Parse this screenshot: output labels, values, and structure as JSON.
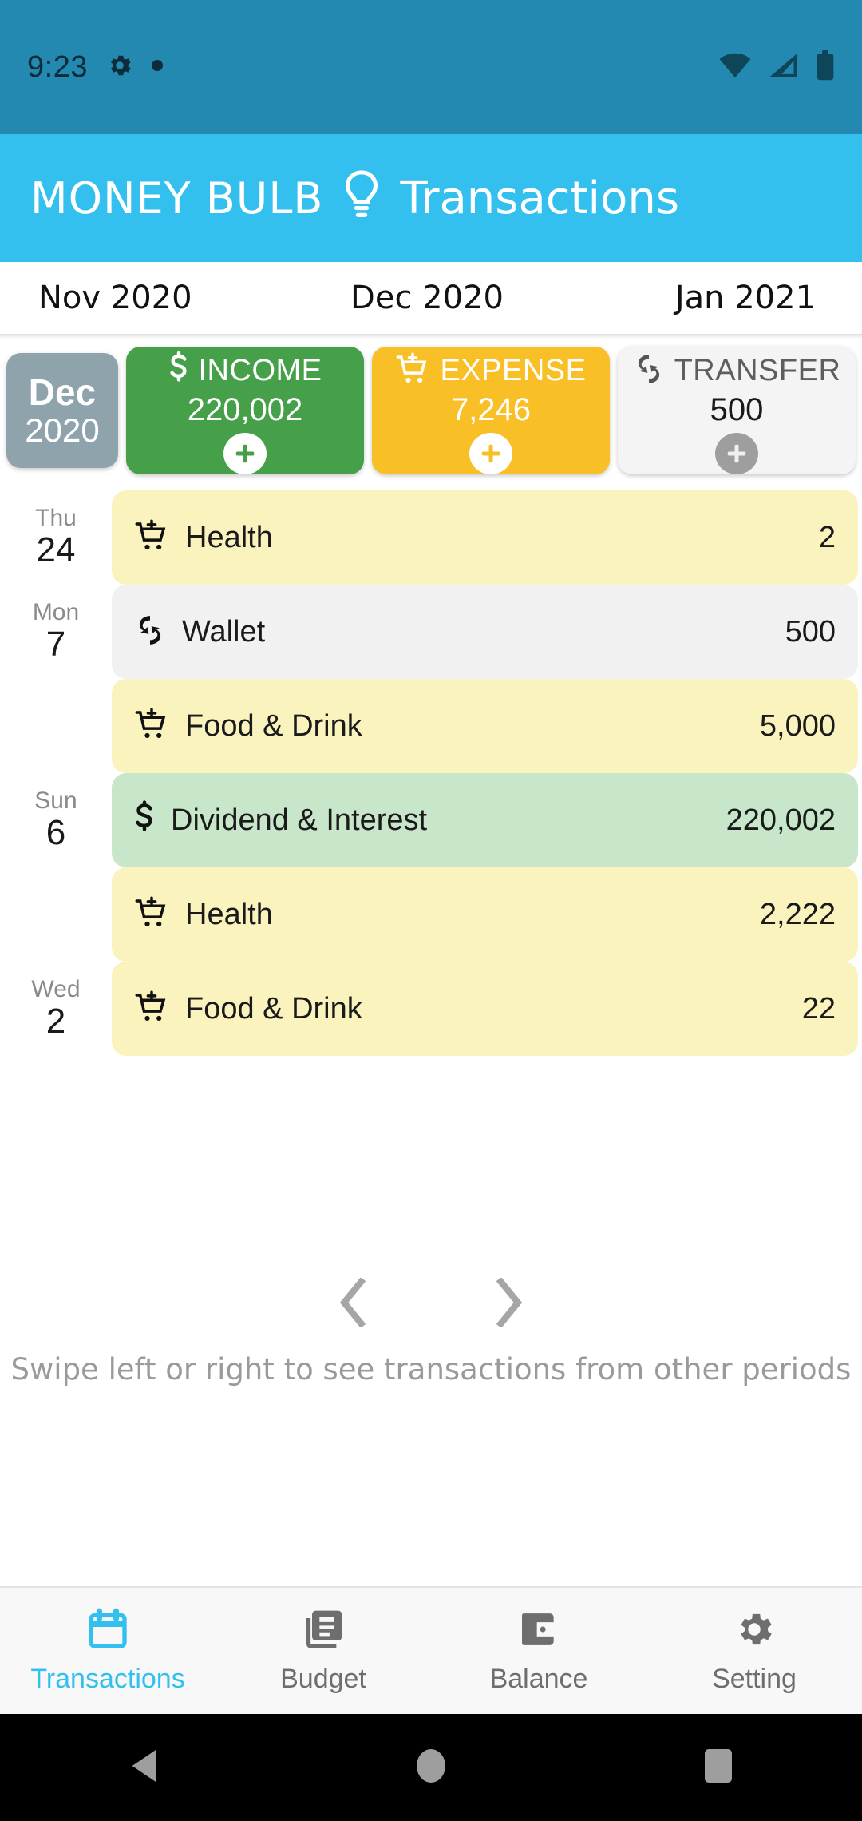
{
  "status_bar": {
    "clock": "9:23",
    "icons_left": [
      "gear-icon",
      "dot-icon"
    ],
    "icons_right": [
      "wifi-icon",
      "signal-icon",
      "battery-icon"
    ],
    "background": "#2389b0"
  },
  "app_bar": {
    "brand": "MONEY BULB",
    "logo_icon": "lightbulb-icon",
    "title": "Transactions",
    "background": "#33c0ef"
  },
  "month_strip": {
    "tabs": [
      {
        "label": "Nov 2020"
      },
      {
        "label": "Dec 2020"
      },
      {
        "label": "Jan 2021"
      }
    ]
  },
  "summary": {
    "period": {
      "month": "Dec",
      "year": "2020",
      "color": "#8fa3ad"
    },
    "cards": [
      {
        "key": "income",
        "label": "INCOME",
        "amount": "220,002",
        "icon": "dollar-icon",
        "color": "#46a049",
        "add_label": "+"
      },
      {
        "key": "expense",
        "label": "EXPENSE",
        "amount": "7,246",
        "icon": "cart-plus-icon",
        "color": "#f8bf26",
        "add_label": "+"
      },
      {
        "key": "transfer",
        "label": "TRANSFER",
        "amount": "500",
        "icon": "transfer-icon",
        "color": "#f4f4f4",
        "add_label": "+"
      }
    ]
  },
  "transactions": [
    {
      "dow": "Thu",
      "day": "24",
      "icon": "cart-plus-icon",
      "category": "Health",
      "amount": "2",
      "type": "expense"
    },
    {
      "dow": "Mon",
      "day": "7",
      "icon": "transfer-icon",
      "category": "Wallet",
      "amount": "500",
      "type": "transfer"
    },
    {
      "dow": "",
      "day": "",
      "icon": "cart-plus-icon",
      "category": "Food & Drink",
      "amount": "5,000",
      "type": "expense"
    },
    {
      "dow": "Sun",
      "day": "6",
      "icon": "dollar-icon",
      "category": "Dividend & Interest",
      "amount": "220,002",
      "type": "income"
    },
    {
      "dow": "",
      "day": "",
      "icon": "cart-plus-icon",
      "category": "Health",
      "amount": "2,222",
      "type": "expense"
    },
    {
      "dow": "Wed",
      "day": "2",
      "icon": "cart-plus-icon",
      "category": "Food & Drink",
      "amount": "22",
      "type": "expense"
    }
  ],
  "swipe_hint": {
    "text": "Swipe left or right to see transactions from other periods",
    "left_icon": "chevron-left-icon",
    "right_icon": "chevron-right-icon"
  },
  "bottom_nav": {
    "active_color": "#33c0ef",
    "items": [
      {
        "label": "Transactions",
        "icon": "calendar-icon",
        "active": true
      },
      {
        "label": "Budget",
        "icon": "document-icon",
        "active": false
      },
      {
        "label": "Balance",
        "icon": "wallet-icon",
        "active": false
      },
      {
        "label": "Setting",
        "icon": "gear-icon",
        "active": false
      }
    ]
  },
  "android_nav": {
    "items": [
      {
        "icon": "back-triangle-icon"
      },
      {
        "icon": "home-circle-icon"
      },
      {
        "icon": "recents-square-icon"
      }
    ]
  }
}
